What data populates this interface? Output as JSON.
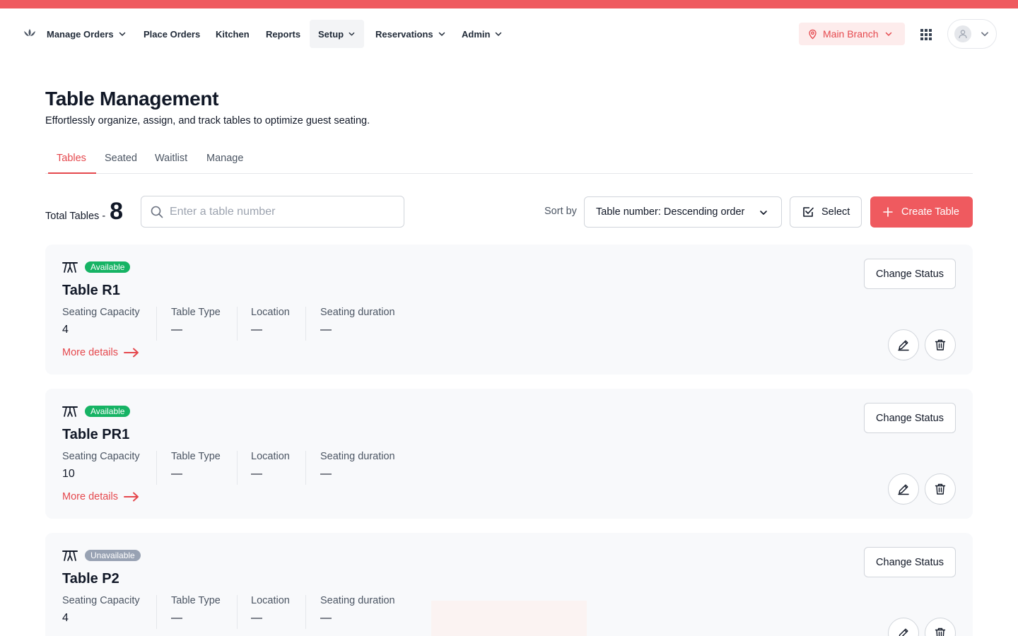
{
  "nav": {
    "items": [
      {
        "label": "Manage Orders",
        "has_dropdown": true
      },
      {
        "label": "Place Orders",
        "has_dropdown": false
      },
      {
        "label": "Kitchen",
        "has_dropdown": false
      },
      {
        "label": "Reports",
        "has_dropdown": false
      },
      {
        "label": "Setup",
        "has_dropdown": true,
        "active": true
      },
      {
        "label": "Reservations",
        "has_dropdown": true
      },
      {
        "label": "Admin",
        "has_dropdown": true
      }
    ],
    "branch": "Main Branch",
    "icons": {
      "logo": "lotus-logo-icon",
      "branch": "map-pin-icon",
      "apps": "grid-apps-icon",
      "profile": "user-icon"
    }
  },
  "colors": {
    "brand": "#ef5a5f",
    "accent_text": "#e5484d",
    "available": "#16b364",
    "unavailable": "#98a2b3",
    "card_bg": "#f8f9fb"
  },
  "header": {
    "title": "Table Management",
    "subtitle": "Effortlessly organize, assign, and track tables to optimize guest seating."
  },
  "tabs": [
    {
      "label": "Tables",
      "active": true
    },
    {
      "label": "Seated",
      "active": false
    },
    {
      "label": "Waitlist",
      "active": false
    },
    {
      "label": "Manage",
      "active": false
    }
  ],
  "toolbar": {
    "total_label": "Total Tables -",
    "total_count": "8",
    "search_placeholder": "Enter a table number",
    "sort_label": "Sort by",
    "sort_value": "Table number: Descending order",
    "select_label": "Select",
    "create_label": "Create Table"
  },
  "card_labels": {
    "capacity": "Seating Capacity",
    "type": "Table Type",
    "location": "Location",
    "duration": "Seating duration",
    "more": "More details",
    "change_status": "Change Status"
  },
  "tables": [
    {
      "name": "Table R1",
      "status": "Available",
      "capacity": "4",
      "type": "—",
      "location": "—",
      "duration": "—"
    },
    {
      "name": "Table PR1",
      "status": "Available",
      "capacity": "10",
      "type": "—",
      "location": "—",
      "duration": "—"
    },
    {
      "name": "Table P2",
      "status": "Unavailable",
      "capacity": "4",
      "type": "—",
      "location": "—",
      "duration": "—"
    }
  ]
}
